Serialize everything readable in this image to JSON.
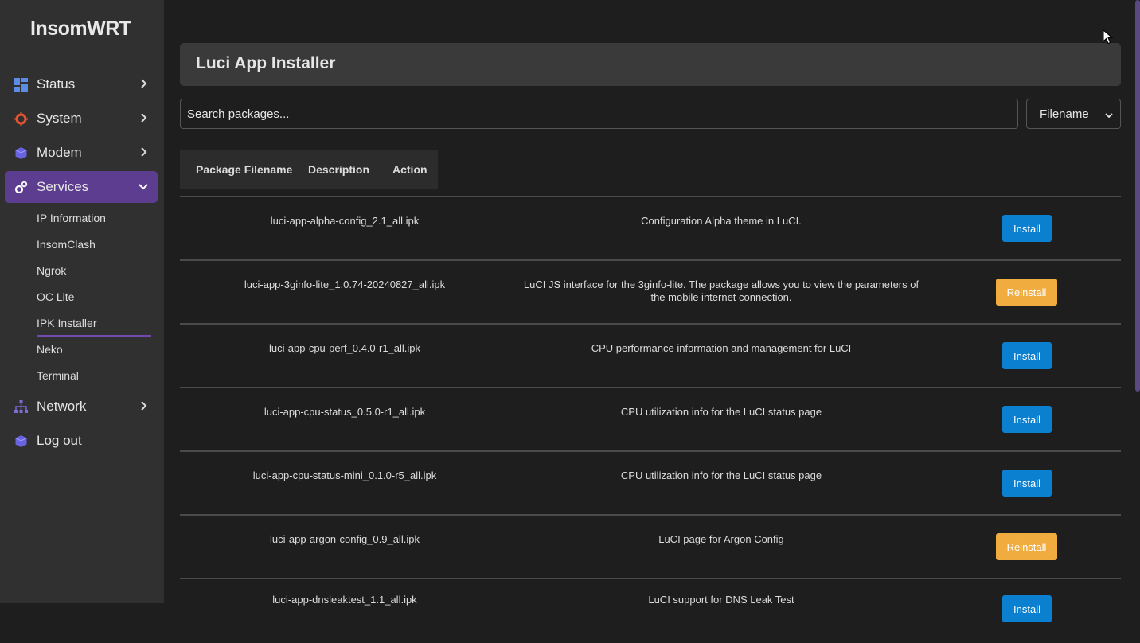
{
  "brand": "InsomWRT",
  "nav": {
    "status": "Status",
    "system": "System",
    "modem": "Modem",
    "services": "Services",
    "network": "Network",
    "logout": "Log out"
  },
  "services_sub": [
    "IP Information",
    "InsomClash",
    "Ngrok",
    "OC Lite",
    "IPK Installer",
    "Neko",
    "Terminal"
  ],
  "page": {
    "title": "Luci App Installer",
    "search_placeholder": "Search packages...",
    "filter_selected": "Filename"
  },
  "table": {
    "headers": [
      "Package Filename",
      "Description",
      "Action"
    ],
    "rows": [
      {
        "file": "luci-app-alpha-config_2.1_all.ipk",
        "desc": "Configuration Alpha theme in LuCI.",
        "action": "Install"
      },
      {
        "file": "luci-app-3ginfo-lite_1.0.74-20240827_all.ipk",
        "desc": "LuCI JS interface for the 3ginfo-lite. The package allows you to view the parameters of the mobile internet connection.",
        "action": "Reinstall"
      },
      {
        "file": "luci-app-cpu-perf_0.4.0-r1_all.ipk",
        "desc": "CPU performance information and management for LuCI",
        "action": "Install"
      },
      {
        "file": "luci-app-cpu-status_0.5.0-r1_all.ipk",
        "desc": "CPU utilization info for the LuCI status page",
        "action": "Install"
      },
      {
        "file": "luci-app-cpu-status-mini_0.1.0-r5_all.ipk",
        "desc": "CPU utilization info for the LuCI status page",
        "action": "Install"
      },
      {
        "file": "luci-app-argon-config_0.9_all.ipk",
        "desc": "LuCI page for Argon Config",
        "action": "Reinstall"
      },
      {
        "file": "luci-app-dnsleaktest_1.1_all.ipk",
        "desc": "LuCI support for DNS Leak Test",
        "action": "Install"
      }
    ]
  },
  "colors": {
    "accent": "#5c3d8f",
    "install": "#0b80d1",
    "reinstall": "#f0ac3e"
  }
}
